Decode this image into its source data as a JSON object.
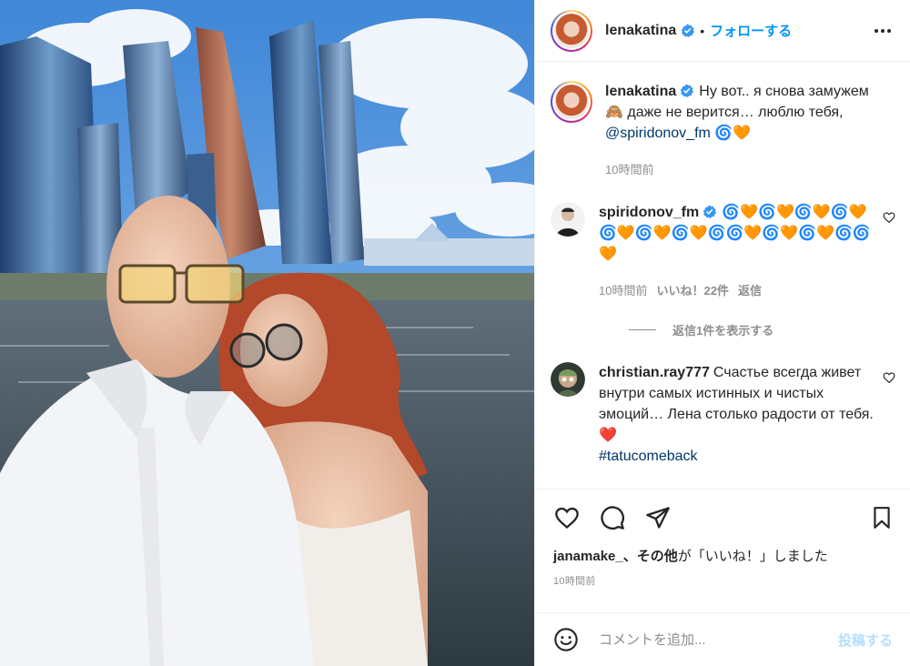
{
  "post": {
    "username": "lenakatina",
    "follow_label": "フォローする",
    "separator": "•"
  },
  "caption": {
    "username": "lenakatina",
    "text_before": "Ну вот.. я снова замужем 🙈 даже не верится… люблю тебя,",
    "mention": "@spiridonov_fm",
    "text_after": "🌀🧡",
    "time": "10時間前"
  },
  "comments": [
    {
      "username": "spiridonov_fm",
      "verified": true,
      "text": "🌀🧡🌀🧡🌀🧡🌀🧡🌀🧡🌀🧡🌀🧡🌀🌀🧡🌀🧡🌀🧡🌀🌀🧡",
      "time": "10時間前",
      "likes": "いいね！22件",
      "reply": "返信",
      "view_replies": "返信1件を表示する"
    },
    {
      "username": "christian.ray777",
      "verified": false,
      "text": "Счастье всегда живет внутри самых истинных и чистых эмоций… Лена столько радости от тебя.❤️",
      "hashtag": "#tatucomeback"
    }
  ],
  "likes_line": {
    "user": "janamake_",
    "others": "、その他",
    "suffix": "が「いいね！」しました"
  },
  "post_time": "10時間前",
  "comment_box": {
    "placeholder": "コメントを追加...",
    "post_label": "投稿する"
  },
  "icons": {
    "verified": "verified-badge-icon",
    "more": "more-options-icon",
    "like": "heart-icon",
    "comment": "comment-bubble-icon",
    "share": "paper-plane-icon",
    "save": "bookmark-icon",
    "emoji": "smiley-icon"
  },
  "colors": {
    "accent": "#0095f6",
    "verified": "#3897f0",
    "meta": "#8e8e8e",
    "mention": "#00376b"
  }
}
